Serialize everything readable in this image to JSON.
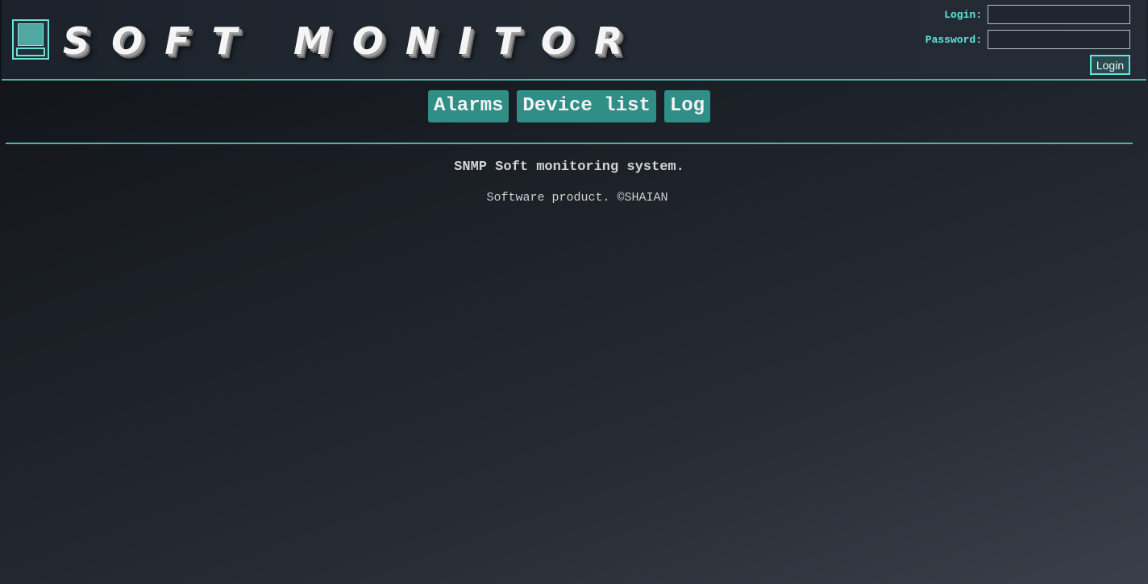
{
  "app": {
    "logo_text": "SOFT MONITOR",
    "logo_icon": "monitor-icon"
  },
  "login_form": {
    "login_label": "Login:",
    "login_value": "",
    "password_label": "Password:",
    "password_value": "",
    "submit_label": "Login"
  },
  "nav": {
    "items": [
      {
        "label": "Alarms"
      },
      {
        "label": "Device list"
      },
      {
        "label": "Log"
      }
    ]
  },
  "intro": {
    "title": "SNMP Soft monitoring system.",
    "subtitle": "Software product. ©SHAIAN"
  },
  "colors": {
    "accent": "#4fb3a6",
    "nav_button_bg": "#2f8f87",
    "label_cyan": "#5fe6dd",
    "background_dark": "#101217",
    "background_light": "#3a3f49"
  }
}
